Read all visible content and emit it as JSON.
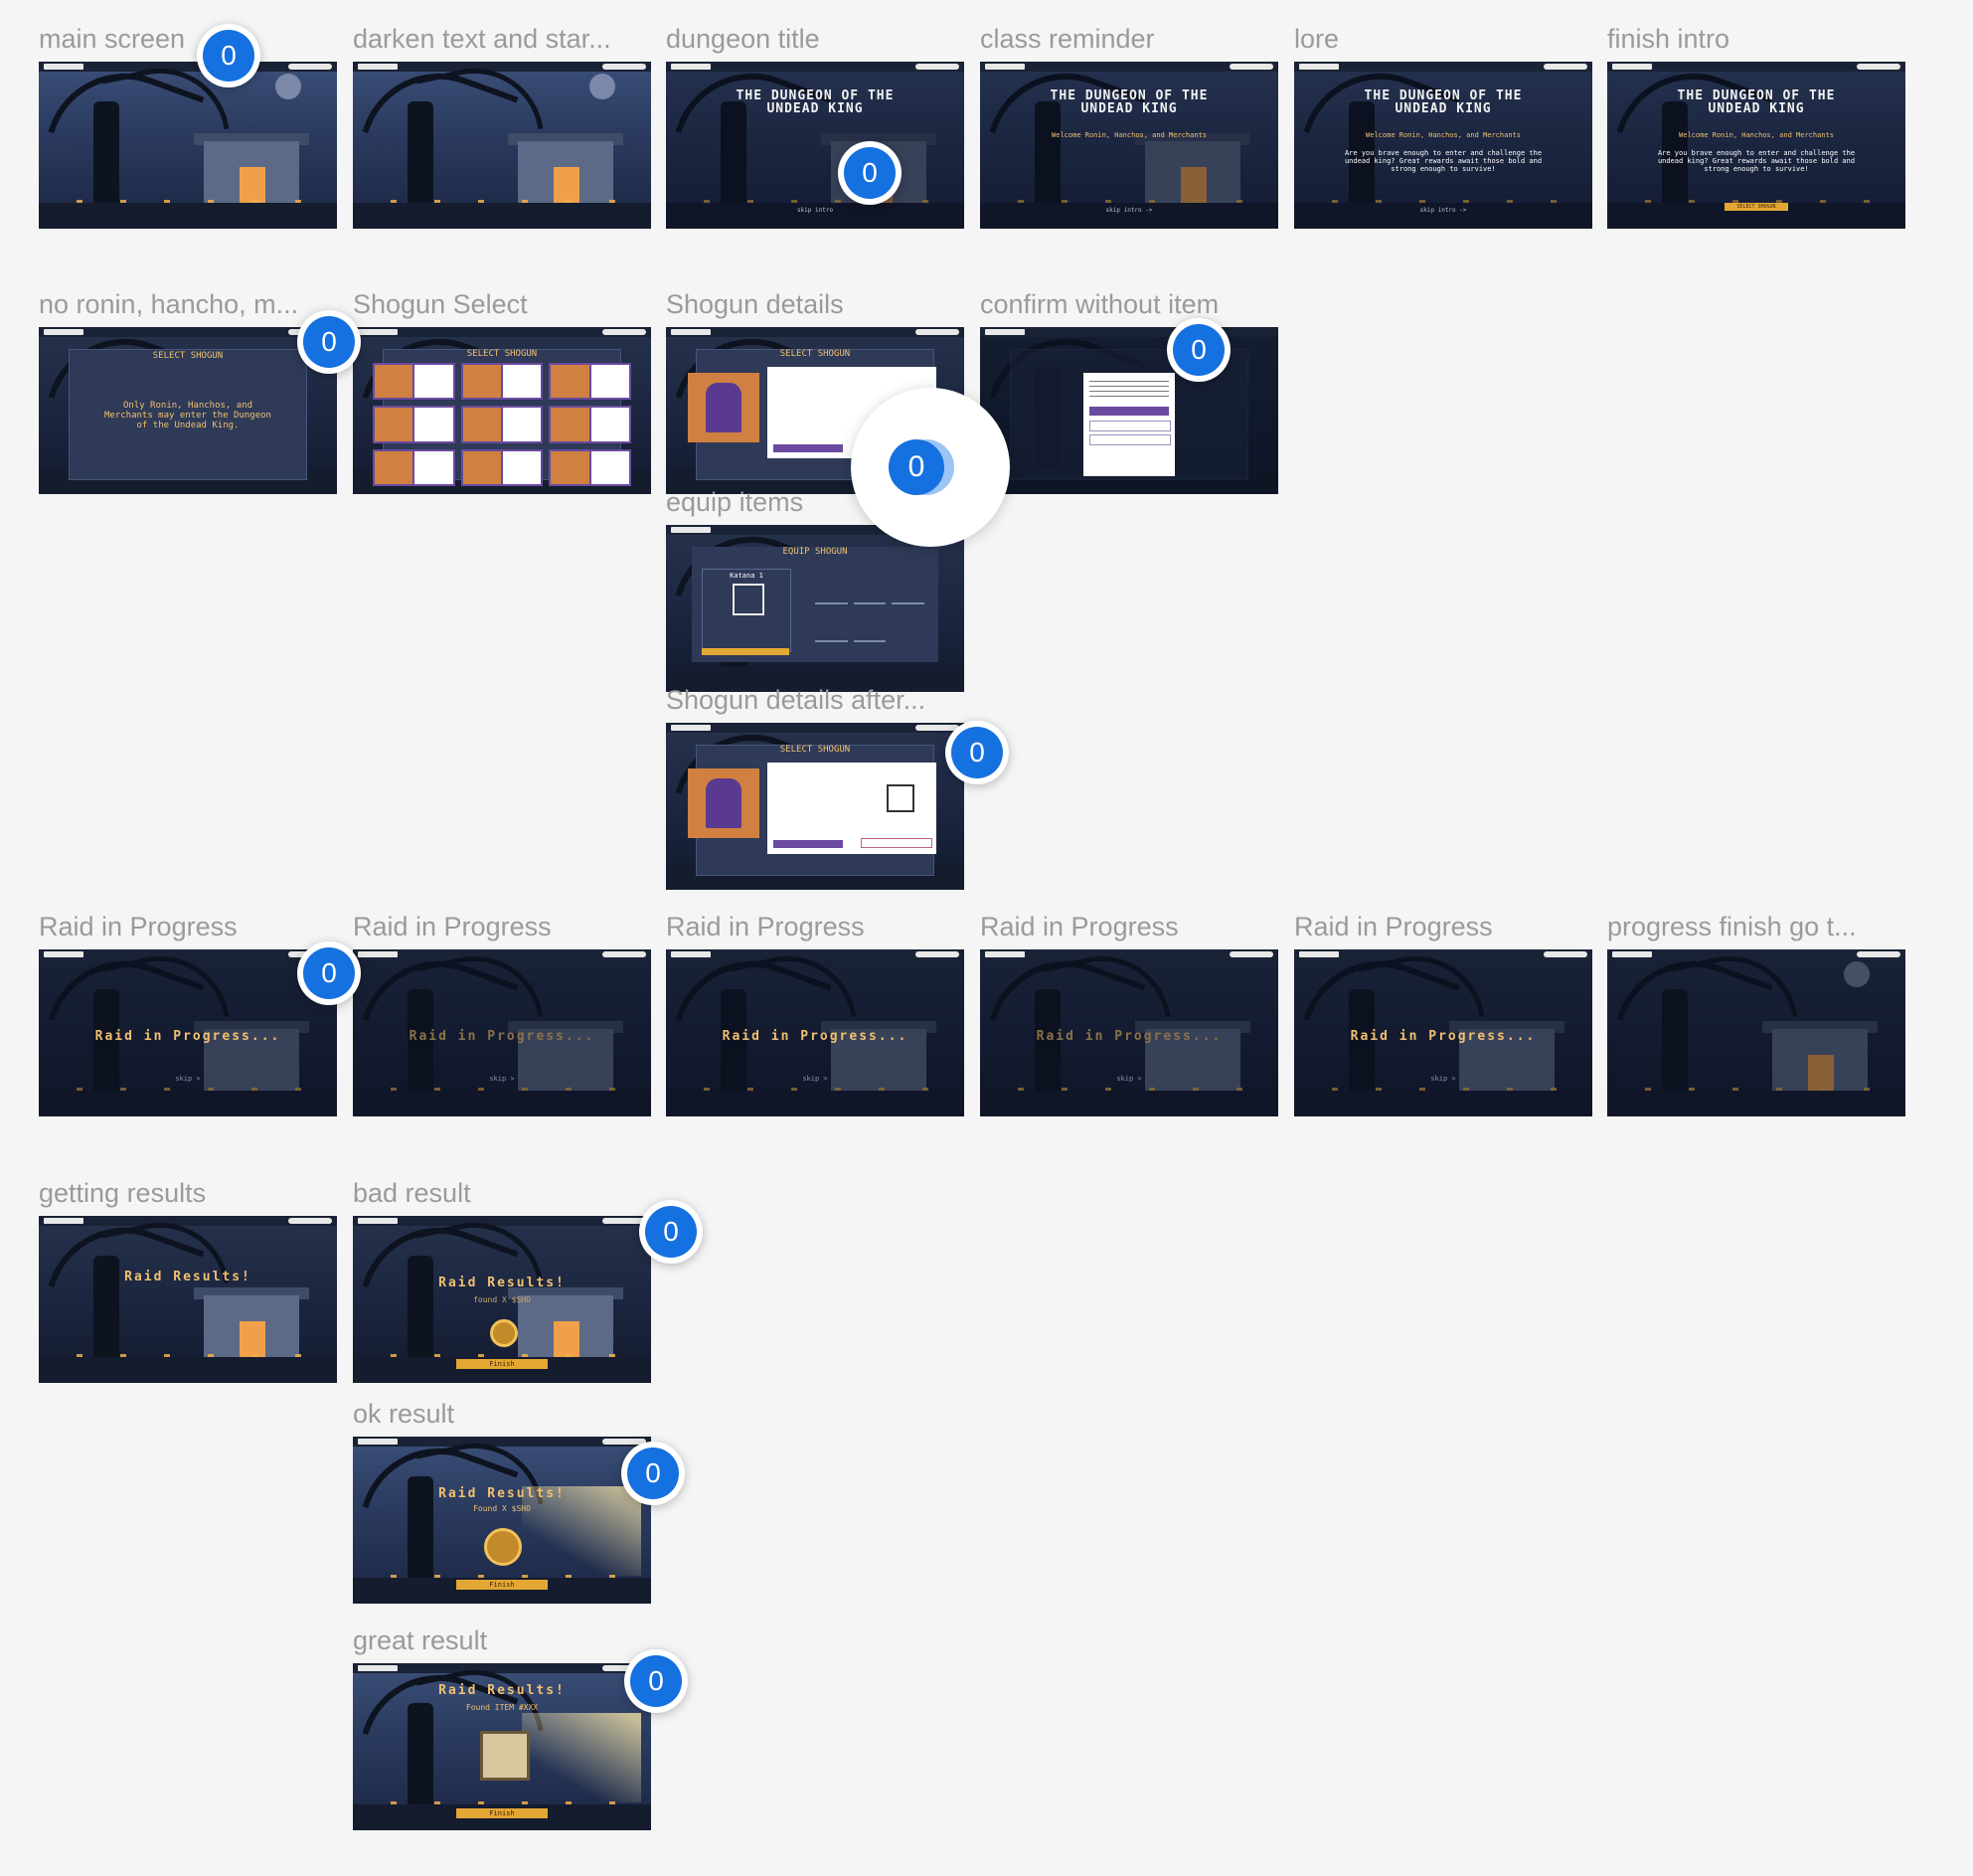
{
  "frames": {
    "main_screen": {
      "label": "main screen"
    },
    "darken": {
      "label": "darken text and star..."
    },
    "dungeon_title": {
      "label": "dungeon title",
      "title_line1": "THE DUNGEON OF THE",
      "title_line2": "UNDEAD KING",
      "skip": "skip intro"
    },
    "class_reminder": {
      "label": "class reminder",
      "title_line1": "THE DUNGEON OF THE",
      "title_line2": "UNDEAD KING",
      "welcome": "Welcome Ronin, Hanchos, and Merchants",
      "skip": "skip intro ->"
    },
    "lore": {
      "label": "lore",
      "title_line1": "THE DUNGEON OF THE",
      "title_line2": "UNDEAD KING",
      "welcome": "Welcome Ronin, Hanchos, and Merchants",
      "lore": "Are you brave enough to enter and challenge the undead king? Great rewards await those bold and strong enough to survive!",
      "skip": "skip intro ->"
    },
    "finish_intro": {
      "label": "finish intro",
      "title_line1": "THE DUNGEON OF THE",
      "title_line2": "UNDEAD KING",
      "welcome": "Welcome Ronin, Hanchos, and Merchants",
      "lore": "Are you brave enough to enter and challenge the undead king? Great rewards await those bold and strong enough to survive!",
      "button": "SELECT SHOGUN"
    },
    "no_ronin": {
      "label": "no ronin, hancho, m...",
      "title": "SELECT SHOGUN",
      "message": "Only Ronin, Hanchos, and Merchants may enter the Dungeon of the Undead King."
    },
    "shogun_select": {
      "label": "Shogun Select",
      "title": "SELECT SHOGUN"
    },
    "shogun_details": {
      "label": "Shogun details",
      "title": "SELECT SHOGUN"
    },
    "confirm_without_item": {
      "label": "confirm without item"
    },
    "equip_items": {
      "label": "equip items",
      "title": "EQUIP SHOGUN",
      "weapon": "Katana 1"
    },
    "shogun_details_after": {
      "label": "Shogun details after...",
      "title": "SELECT SHOGUN"
    },
    "raid1": {
      "label": "Raid in Progress",
      "text": "Raid in Progress...",
      "skip": "skip >"
    },
    "raid2": {
      "label": "Raid in Progress",
      "text": "Raid in Progress...",
      "skip": "skip >"
    },
    "raid3": {
      "label": "Raid in Progress",
      "text": "Raid in Progress...",
      "skip": "skip >"
    },
    "raid4": {
      "label": "Raid in Progress",
      "text": "Raid in Progress...",
      "skip": "skip >"
    },
    "raid5": {
      "label": "Raid in Progress",
      "text": "Raid in Progress...",
      "skip": "skip >"
    },
    "progress_finish": {
      "label": "progress finish go t..."
    },
    "getting_results": {
      "label": "getting results",
      "title": "Raid Results!"
    },
    "bad_result": {
      "label": "bad result",
      "title": "Raid Results!",
      "found": "found X $SHO",
      "button": "Finish"
    },
    "ok_result": {
      "label": "ok result",
      "title": "Raid Results!",
      "found": "Found X $SHO",
      "button": "Finish"
    },
    "great_result": {
      "label": "great result",
      "title": "Raid Results!",
      "found": "Found ITEM #XXX",
      "button": "Finish"
    }
  },
  "comment_count": "0",
  "colors": {
    "accent": "#1570e0",
    "gold": "#e5a734",
    "purple": "#6a4aa0",
    "canvas": "#f5f5f5"
  }
}
